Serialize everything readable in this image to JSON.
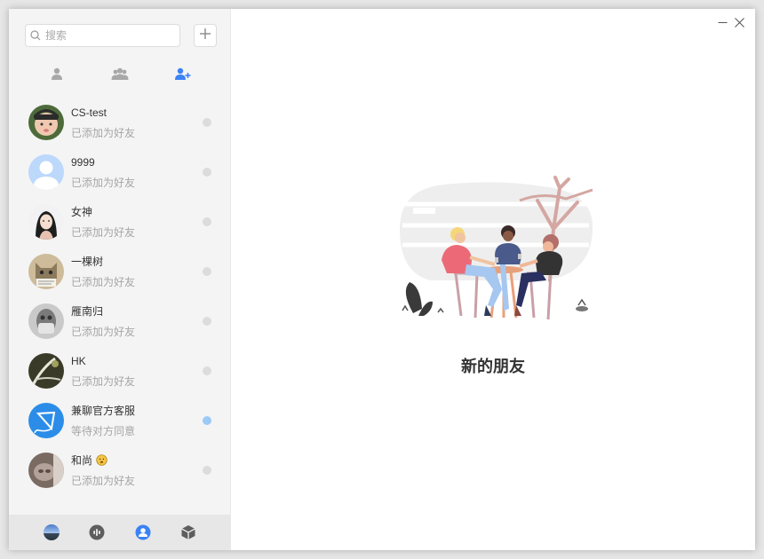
{
  "search": {
    "placeholder": "搜索"
  },
  "tabs": [
    {
      "icon": "contact-icon"
    },
    {
      "icon": "group-icon"
    },
    {
      "icon": "add-friend-icon"
    }
  ],
  "friends": [
    {
      "name": "CS-test",
      "status": "已添加为好友"
    },
    {
      "name": "9999",
      "status": "已添加为好友"
    },
    {
      "name": "女神",
      "status": "已添加为好友"
    },
    {
      "name": "一棵树",
      "status": "已添加为好友"
    },
    {
      "name": "雁南归",
      "status": "已添加为好友"
    },
    {
      "name": "HK",
      "status": "已添加为好友"
    },
    {
      "name": "兼聊官方客服",
      "status": "等待对方同意"
    },
    {
      "name": "和尚",
      "status": "已添加为好友"
    }
  ],
  "main": {
    "title": "新的朋友"
  },
  "colors": {
    "accent": "#3b82f6",
    "pending_dot": "#9ccaf7",
    "idle_dot": "#dcdcdc"
  }
}
